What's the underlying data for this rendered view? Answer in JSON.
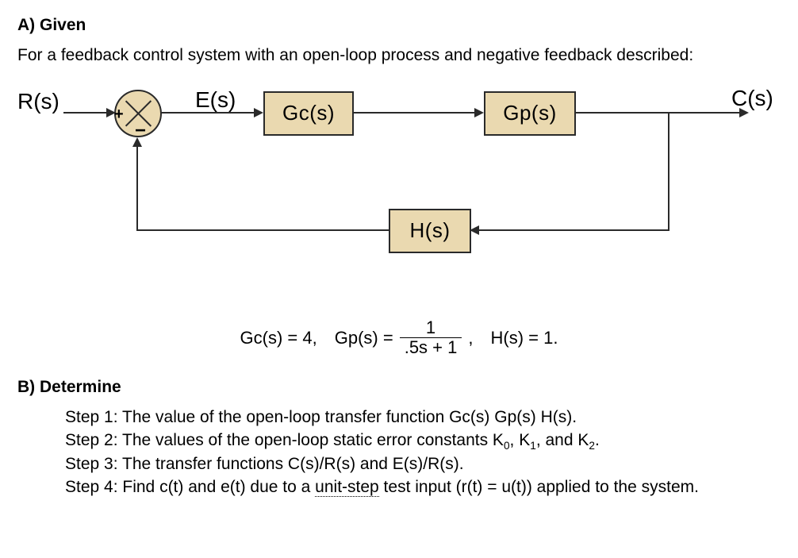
{
  "section_a_heading": "A) Given",
  "intro": "For a feedback control system with an open-loop process and negative feedback described:",
  "diagram": {
    "R": "R(s)",
    "E": "E(s)",
    "C": "C(s)",
    "Gc": "Gc(s)",
    "Gp": "Gp(s)",
    "H": "H(s)",
    "plus": "+",
    "minus": "−"
  },
  "equation": {
    "gc": "Gc(s) = 4,",
    "gp_lhs": "Gp(s) =",
    "gp_num": "1",
    "gp_den": ".5s + 1",
    "comma": ",",
    "hs": "H(s) = 1."
  },
  "section_b_heading": "B) Determine",
  "steps": {
    "s1": "Step 1: The value of the open-loop transfer function Gc(s) Gp(s) H(s).",
    "s2a": "Step 2: The values of the open-loop static error constants K",
    "s2_k0": "0",
    "s2b": ", K",
    "s2_k1": "1",
    "s2c": ", and K",
    "s2_k2": "2",
    "s2d": ".",
    "s3": "Step 3: The transfer functions C(s)/R(s) and E(s)/R(s).",
    "s4a": "Step 4: Find c(t) and e(t) due to a ",
    "s4_underlined": "unit-step",
    "s4b": " test input (r(t) = u(t)) applied to the system."
  }
}
